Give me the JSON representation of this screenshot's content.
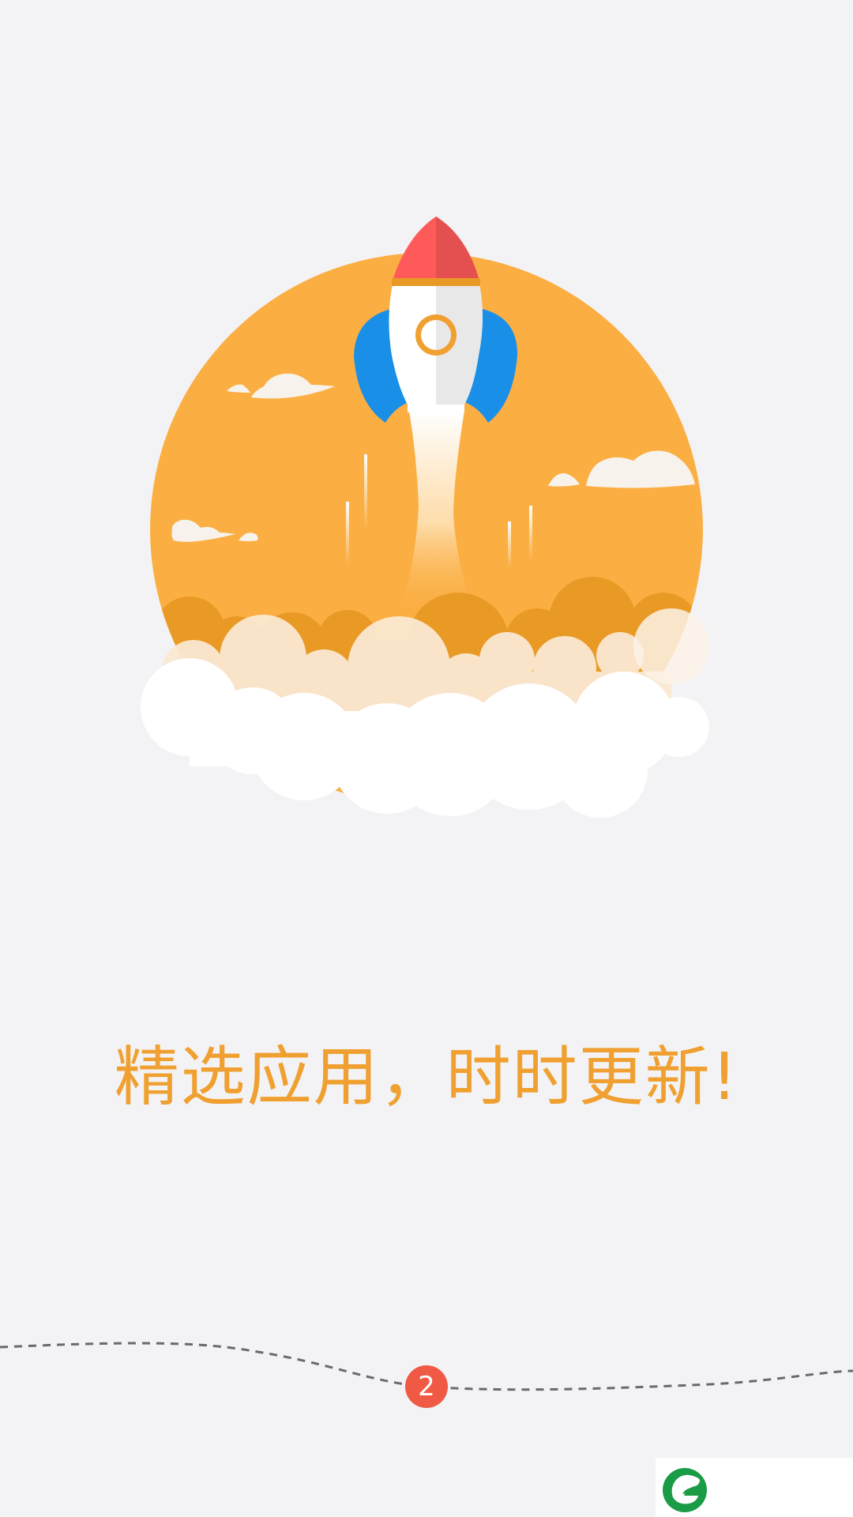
{
  "onboarding": {
    "tagline": "精选应用，时时更新!",
    "page_number": "2"
  },
  "icons": {
    "illustration": "rocket-launch-illustration",
    "logo": "leaf-logo-icon"
  },
  "colors": {
    "accent": "#f0a030",
    "sun": "#fbae42",
    "cloud_dark": "#e99a25",
    "rocket_nose": "#ff5a5a",
    "rocket_fins": "#1a8fe8",
    "indicator": "#f05a45",
    "brand_green": "#1a9b46",
    "background": "#f3f3f5"
  }
}
